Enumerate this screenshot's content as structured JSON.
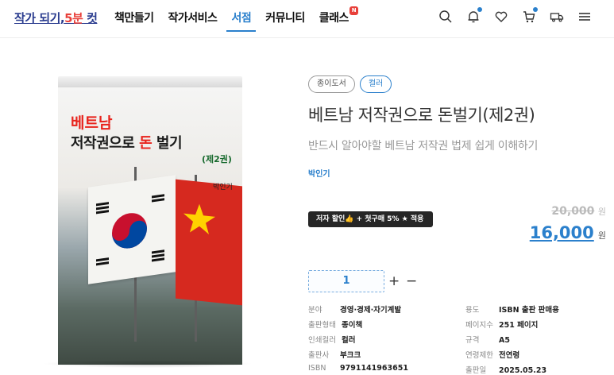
{
  "header": {
    "logo": {
      "part1": "작가 되기,",
      "part2": "5분",
      "part3": " 컷"
    },
    "nav": [
      {
        "label": "책만들기",
        "active": false,
        "badge": ""
      },
      {
        "label": "작가서비스",
        "active": false,
        "badge": ""
      },
      {
        "label": "서점",
        "active": true,
        "badge": ""
      },
      {
        "label": "커뮤니티",
        "active": false,
        "badge": ""
      },
      {
        "label": "클래스",
        "active": false,
        "badge": "N"
      }
    ],
    "icons": [
      "search-icon",
      "bell-icon",
      "heart-icon",
      "cart-icon",
      "delivery-truck-icon",
      "menu-icon"
    ],
    "accent_color": "#2b80cc"
  },
  "cover": {
    "line1": "베트남",
    "line2a": "저작권으로 ",
    "line2b": "돈",
    "line2c": "  벌기",
    "line3": "(제2권)",
    "author": "박인기"
  },
  "product": {
    "tags": [
      "종이도서",
      "컬러"
    ],
    "title": "베트남 저작권으로 돈벌기(제2권)",
    "subtitle": "반드시 알아야할 베트남 저작권 법제 쉽게 이해하기",
    "author": "박인기",
    "promo": "저자 할인👍 + 첫구매 5% ★ 적용",
    "original_price": "20,000",
    "price": "16,000",
    "currency": "원",
    "quantity": "1",
    "plus_label": "+",
    "minus_label": "−"
  },
  "specs": [
    {
      "label": "분야",
      "value": "경영·경제·자기계발"
    },
    {
      "label": "용도",
      "value": "ISBN 출판 판매용"
    },
    {
      "label": "출판형태",
      "value": "종이책"
    },
    {
      "label": "페이지수",
      "value": "251 페이지"
    },
    {
      "label": "인쇄컬러",
      "value": "컬러"
    },
    {
      "label": "규격",
      "value": "A5"
    },
    {
      "label": "출판사",
      "value": "부크크"
    },
    {
      "label": "연령제한",
      "value": "전연령"
    },
    {
      "label": "ISBN",
      "value": "9791141963651"
    },
    {
      "label": "출판일",
      "value": "2025.05.23"
    }
  ]
}
